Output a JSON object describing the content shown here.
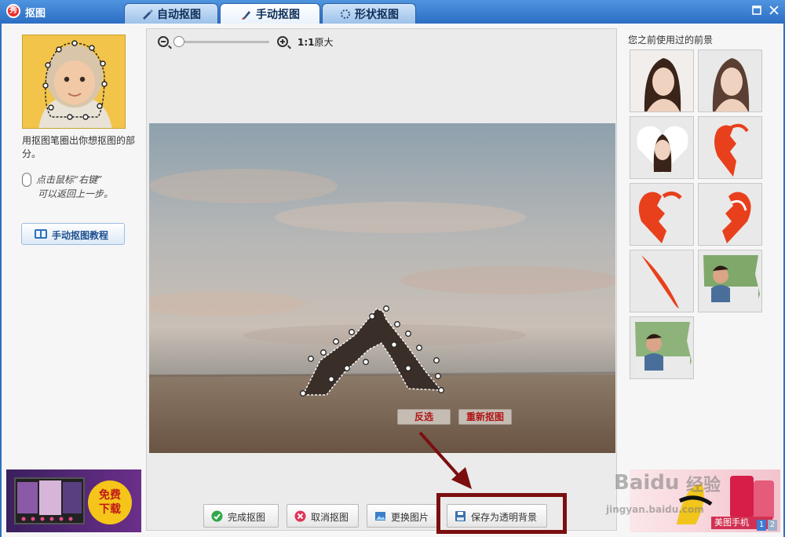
{
  "window": {
    "title": "抠图",
    "app_icon_glyph": "秀",
    "tabs": [
      {
        "label": "自动抠图",
        "icon": "brush-icon",
        "active": false
      },
      {
        "label": "手动抠图",
        "icon": "pen-icon",
        "active": true
      },
      {
        "label": "形状抠图",
        "icon": "shape-icon",
        "active": false
      }
    ]
  },
  "left": {
    "description": "用抠图笔圈出你想抠图的部分。",
    "tip_line1": "点击鼠标“右键”",
    "tip_line2": "可以返回上一步。",
    "tutorial_button": "手动抠图教程",
    "ad_badge_line1": "免费",
    "ad_badge_line2": "下载"
  },
  "toolbar": {
    "ratio_bold": "1:1",
    "ratio_text": "原大",
    "zoom_level_fraction": 0.0
  },
  "canvas": {
    "invert_button": "反选",
    "reset_button": "重新抠图"
  },
  "bottom_buttons": {
    "finish": "完成抠图",
    "cancel": "取消抠图",
    "change": "更换图片",
    "save_transparent": "保存为透明背景"
  },
  "right": {
    "title": "您之前使用过的前景",
    "items": [
      {
        "icon": "portrait-icon"
      },
      {
        "icon": "portrait-icon"
      },
      {
        "icon": "heart-portrait-icon"
      },
      {
        "icon": "broken-heart-icon"
      },
      {
        "icon": "broken-heart-icon"
      },
      {
        "icon": "broken-heart-icon"
      },
      {
        "icon": "feather-icon"
      },
      {
        "icon": "person-photo-icon"
      },
      {
        "icon": "person-photo-icon"
      }
    ],
    "ad_label": "美图手机",
    "pager": [
      "1",
      "2"
    ]
  },
  "watermark": {
    "logo": "Baidu",
    "logo_suffix": "经验",
    "url": "jingyan.baidu.com"
  },
  "colors": {
    "accent_blue": "#2c6ec4",
    "highlight_red": "#7b0f10",
    "heart_red": "#e8401c"
  }
}
